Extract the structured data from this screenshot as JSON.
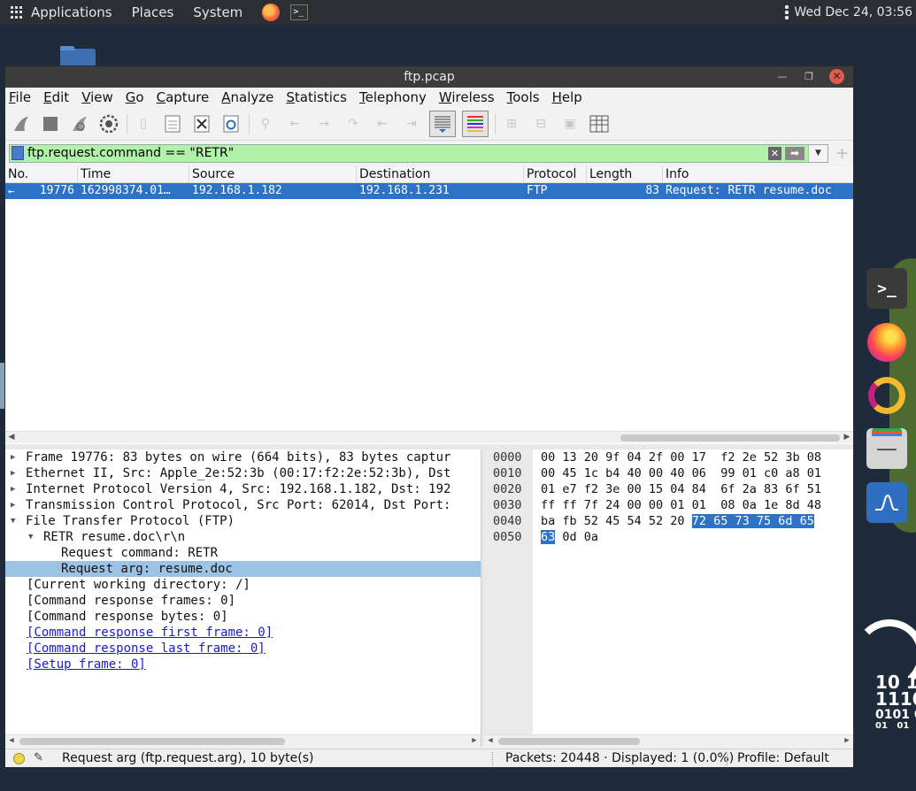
{
  "topbar": {
    "menus": [
      "Applications",
      "Places",
      "System"
    ],
    "clock": "Wed Dec 24, 03:56"
  },
  "window": {
    "title": "ftp.pcap"
  },
  "menubar": [
    "File",
    "Edit",
    "View",
    "Go",
    "Capture",
    "Analyze",
    "Statistics",
    "Telephony",
    "Wireless",
    "Tools",
    "Help"
  ],
  "filter": {
    "value": "ftp.request.command == \"RETR\"",
    "bg_color": "#aff2a8"
  },
  "packet_list": {
    "columns": [
      "No.",
      "Time",
      "Source",
      "Destination",
      "Protocol",
      "Length",
      "Info"
    ],
    "rows": [
      {
        "no": "19776",
        "time": "162998374.01…",
        "source": "192.168.1.182",
        "destination": "192.168.1.231",
        "protocol": "FTP",
        "length": "83",
        "info": "Request: RETR resume.doc"
      }
    ],
    "selected_color": "#2c72c7"
  },
  "details": [
    "Frame 19776: 83 bytes on wire (664 bits), 83 bytes captur",
    "Ethernet II, Src: Apple_2e:52:3b (00:17:f2:2e:52:3b), Dst",
    "Internet Protocol Version 4, Src: 192.168.1.182, Dst: 192",
    "Transmission Control Protocol, Src Port: 62014, Dst Port:",
    "File Transfer Protocol (FTP)",
    "RETR resume.doc\\r\\n",
    "Request command: RETR",
    "Request arg: resume.doc",
    "[Current working directory: /]",
    "[Command response frames: 0]",
    "[Command response bytes: 0]",
    "[Command response first frame: 0]",
    "[Command response last frame: 0]",
    "[Setup frame: 0]"
  ],
  "hex": {
    "offsets": [
      "0000",
      "0010",
      "0020",
      "0030",
      "0040",
      "0050"
    ],
    "rows": [
      "00 13 20 9f 04 2f 00 17  f2 2e 52 3b 08",
      "00 45 1c b4 40 00 40 06  99 01 c0 a8 01",
      "01 e7 f2 3e 00 15 04 84  6f 2a 83 6f 51",
      "ff ff 7f 24 00 00 01 01  08 0a 1e 8d 48",
      "ba fb 52 45 54 52 20 ",
      ""
    ],
    "hl_row4": "72 65 73 75 6d 65",
    "hl_row5": "63",
    "row5_rest": " 0d 0a"
  },
  "status": {
    "message": "Request arg (ftp.request.arg), 10 byte(s)",
    "packets": "Packets: 20448 · Displayed: 1 (0.0%)",
    "profile": "Profile: Default"
  },
  "icons": [
    "apps-grid-icon",
    "firefox-icon",
    "terminal-icon",
    "shark-fin-icon",
    "stop-icon",
    "restart-icon",
    "gear-icon",
    "save-icon",
    "close-file-icon",
    "reload-icon",
    "search-icon",
    "back-icon",
    "forward-icon",
    "colorize-icon",
    "autoscroll-icon",
    "zoom-in-icon",
    "zoom-out-icon",
    "normal-size-icon",
    "resize-columns-icon"
  ]
}
